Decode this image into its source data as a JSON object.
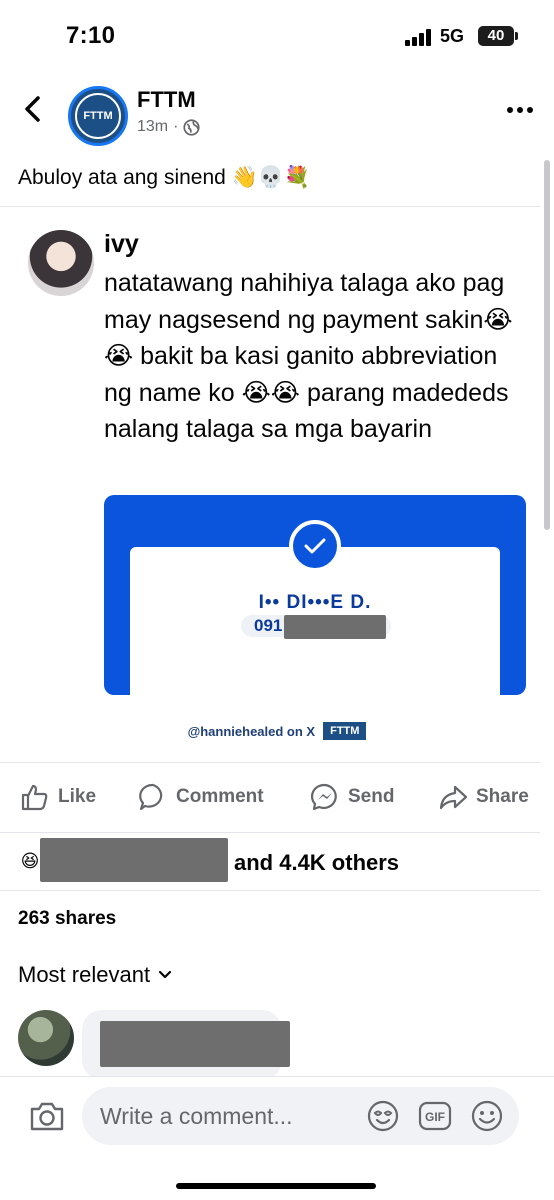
{
  "status": {
    "time": "7:10",
    "network": "5G",
    "battery": "40"
  },
  "post": {
    "page_name": "FTTM",
    "page_avatar_text": "FTTM",
    "time_ago": "13m",
    "separator": "·",
    "caption": "Abuloy ata ang sinend 👋💀💐"
  },
  "tweet": {
    "author": "ivy",
    "text": "natatawang nahihiya talaga ako pag may nagsesend ng payment sakin😭😭 bakit ba kasi ganito abbreviation ng name ko 😭😭 parang madededs nalang talaga sa mga bayarin",
    "receipt": {
      "masked_name": "I•• DI•••E D.",
      "number_prefix": "091"
    },
    "watermark": {
      "handle": "@hanniehealed on X",
      "logo": "FTTM"
    }
  },
  "actions": {
    "like": "Like",
    "comment": "Comment",
    "send": "Send",
    "share": "Share"
  },
  "reactions": {
    "emoji": "😆",
    "others_text": "and 4.4K others"
  },
  "shares_text": "263 shares",
  "sort_label": "Most relevant",
  "composer": {
    "placeholder": "Write a comment..."
  },
  "icons": [
    "back-icon",
    "globe-icon",
    "more-icon",
    "check-icon",
    "like-icon",
    "comment-icon",
    "messenger-icon",
    "share-icon",
    "chevron-down-icon",
    "camera-icon",
    "avatar-sticker-icon",
    "gif-icon",
    "emoji-icon"
  ],
  "colors": {
    "facebook_blue": "#1877f2",
    "receipt_blue": "#0a55dc",
    "muted": "#65676b"
  }
}
